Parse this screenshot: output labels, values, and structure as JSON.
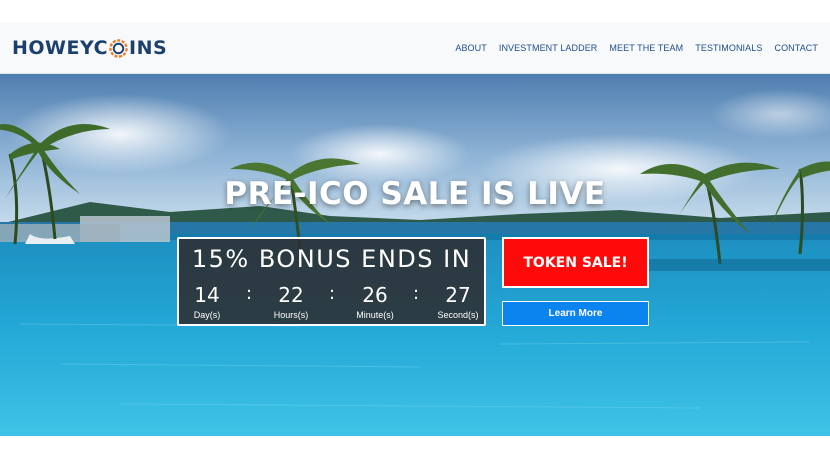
{
  "brand": {
    "logo_text_left": "HOWEYC",
    "logo_text_right": "INS"
  },
  "nav": {
    "items": [
      {
        "label": "ABOUT"
      },
      {
        "label": "INVESTMENT LADDER"
      },
      {
        "label": "MEET THE TEAM"
      },
      {
        "label": "TESTIMONIALS"
      },
      {
        "label": "CONTACT"
      }
    ]
  },
  "hero": {
    "headline": "PRE-ICO SALE IS LIVE",
    "countdown": {
      "title": "15% BONUS ENDS IN",
      "units": [
        {
          "value": "14",
          "label": "Day(s)"
        },
        {
          "value": "22",
          "label": "Hours(s)"
        },
        {
          "value": "26",
          "label": "Minute(s)"
        },
        {
          "value": "27",
          "label": "Second(s)"
        }
      ],
      "separator": ":"
    },
    "token_sale_label": "TOKEN SALE!",
    "learn_more_label": "Learn More"
  },
  "colors": {
    "logo": "#1c3f6e",
    "nav_link": "#1f4e88",
    "token_button": "#ff0a0a",
    "learn_button": "#0b84f0",
    "countdown_bg": "#2d2d30"
  },
  "icons": {
    "logo_coin": "coin-icon"
  }
}
